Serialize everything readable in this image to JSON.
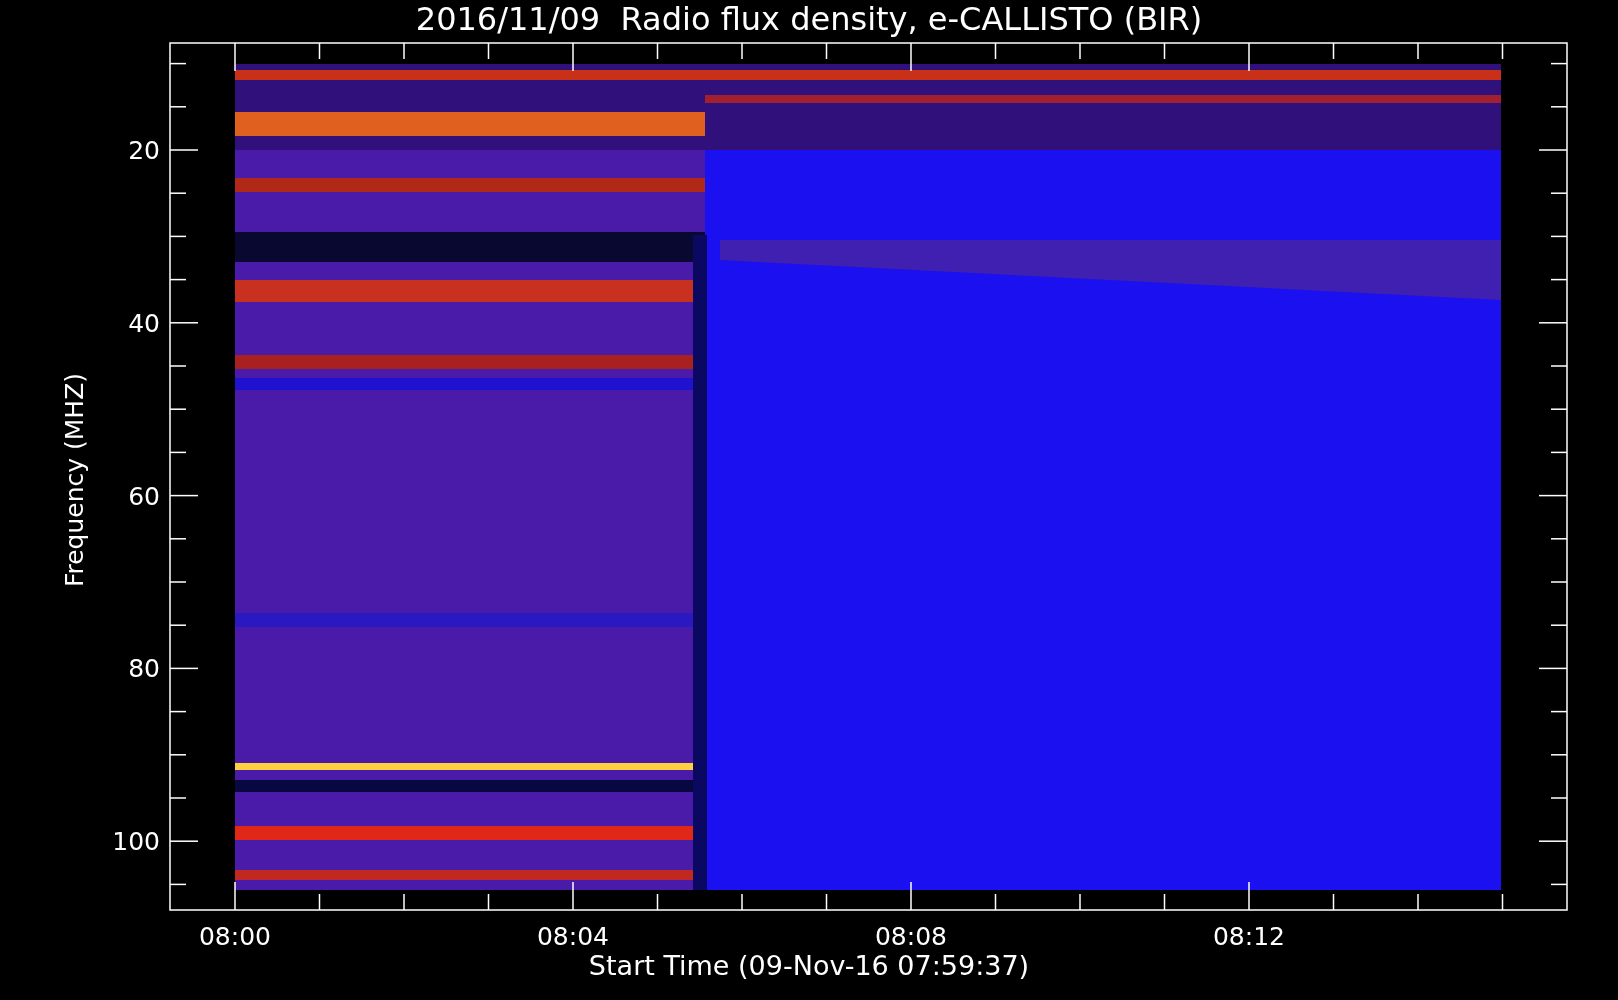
{
  "title": "2016/11/09  Radio flux density, e-CALLISTO (BIR)",
  "y_axis": {
    "label": "Frequency (MHZ)",
    "ticks": [
      "20",
      "40",
      "60",
      "80",
      "100"
    ]
  },
  "x_axis": {
    "label": "Start Time (09-Nov-16 07:59:37)",
    "ticks": [
      "08:00",
      "08:04",
      "08:08",
      "08:12"
    ]
  }
}
